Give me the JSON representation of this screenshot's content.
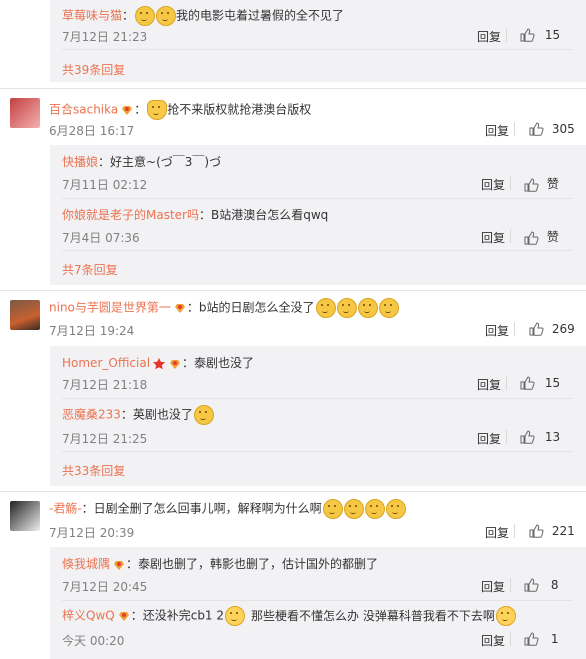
{
  "thread1": {
    "reply1": {
      "name": "草莓味与猫",
      "text": "我的电影屯着过暑假的全不见了",
      "time": "7月12日 21:23",
      "reply": "回复",
      "likes": "15"
    },
    "more": "共39条回复"
  },
  "thread2": {
    "name": "百合sachika",
    "text": "抢不来版权就抢港澳台版权",
    "time": "6月28日 16:17",
    "reply": "回复",
    "likes": "305",
    "reply1": {
      "name": "快播娘",
      "text": "：好主意~(づ￣3￣)づ",
      "time": "7月11日 02:12",
      "reply": "回复",
      "likes": "赞"
    },
    "reply2": {
      "name": "你娘就是老子的Master吗",
      "text": "：B站港澳台怎么看qwq",
      "time": "7月4日 07:36",
      "reply": "回复",
      "likes": "赞"
    },
    "more": "共7条回复"
  },
  "thread3": {
    "name": "nino与芋圆是世界第一",
    "text": "：b站的日剧怎么全没了",
    "time": "7月12日 19:24",
    "reply": "回复",
    "likes": "269",
    "reply1": {
      "name": "Homer_Official",
      "text": "：泰剧也没了",
      "time": "7月12日 21:18",
      "reply": "回复",
      "likes": "15"
    },
    "reply2": {
      "name": "恶魔桑233",
      "text": "：英剧也没了",
      "time": "7月12日 21:25",
      "reply": "回复",
      "likes": "13"
    },
    "more": "共33条回复"
  },
  "thread4": {
    "name": "-君觞-",
    "text": "：日剧全删了怎么回事儿啊，解释啊为什么啊",
    "time": "7月12日 20:39",
    "reply": "回复",
    "likes": "221",
    "reply1": {
      "name": "倏我城隅",
      "text": "：泰剧也删了，韩影也删了，估计国外的都删了",
      "time": "7月12日 20:45",
      "reply": "回复",
      "likes": "8"
    },
    "reply2": {
      "name": "梓义QwQ",
      "text1": "：还没补完cb1 2",
      "text2": "那些梗看不懂怎么办 没弹幕科普我看不下去啊",
      "time": "今天 00:20",
      "reply": "回复",
      "likes": "1"
    }
  },
  "colors": {
    "name": "#eb7350",
    "reply_bg": "#f2f2f5",
    "text": "#333333",
    "time": "#808080"
  }
}
